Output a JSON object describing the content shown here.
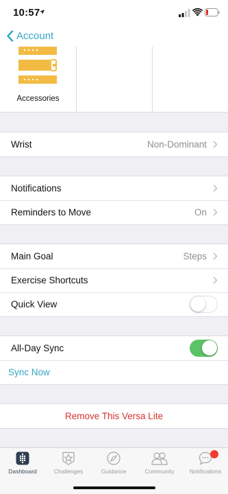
{
  "status_bar": {
    "time": "10:57",
    "battery_color": "#e0302a"
  },
  "nav": {
    "back_label": "Account"
  },
  "accessories": {
    "label": "Accessories",
    "accent_color": "#f2bb44"
  },
  "wrist": {
    "label": "Wrist",
    "value": "Non-Dominant"
  },
  "notifications_section": {
    "notifications_label": "Notifications",
    "reminders_label": "Reminders to Move",
    "reminders_value": "On"
  },
  "goals_section": {
    "main_goal_label": "Main Goal",
    "main_goal_value": "Steps",
    "exercise_shortcuts_label": "Exercise Shortcuts",
    "quick_view_label": "Quick View",
    "quick_view_enabled": false
  },
  "sync_section": {
    "all_day_sync_label": "All-Day Sync",
    "all_day_sync_enabled": true,
    "sync_now_label": "Sync Now"
  },
  "remove": {
    "label": "Remove This Versa Lite"
  },
  "tab_bar": {
    "tabs": [
      {
        "label": "Dashboard",
        "icon": "dashboard-icon",
        "active": true
      },
      {
        "label": "Challenges",
        "icon": "star-icon",
        "active": false
      },
      {
        "label": "Guidance",
        "icon": "compass-icon",
        "active": false
      },
      {
        "label": "Community",
        "icon": "people-icon",
        "active": false
      },
      {
        "label": "Notifications",
        "icon": "chat-bubble-icon",
        "active": false,
        "badge": true
      }
    ]
  },
  "colors": {
    "accent": "#35a6c5",
    "toggle_on": "#5cc267",
    "destructive": "#d6322d",
    "badge": "#f23b2e"
  }
}
